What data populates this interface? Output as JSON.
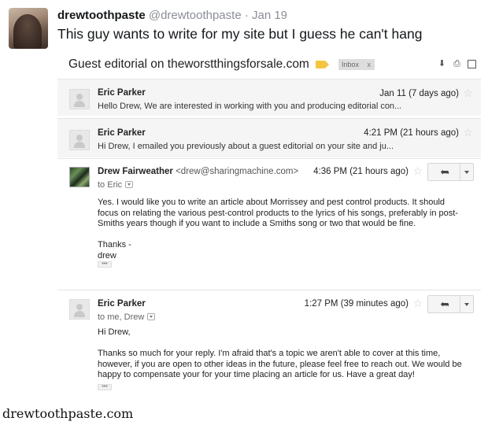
{
  "tweet": {
    "author_name": "drewtoothpaste",
    "author_handle": "@drewtoothpaste",
    "date": "· Jan 19",
    "text": "This guy wants to write for my site but I guess he can't hang"
  },
  "thread": {
    "subject": "Guest editorial on theworstthingsforsale.com",
    "label_chip": "Inbox",
    "label_chip_close": "x",
    "icons": [
      "download-icon",
      "print-icon",
      "new-window-icon"
    ],
    "messages": [
      {
        "sender": "Eric Parker",
        "when": "Jan 11 (7 days ago)",
        "snippet": "Hello Drew, We are interested in working with you and producing editorial con..."
      },
      {
        "sender": "Eric Parker",
        "when": "4:21 PM (21 hours ago)",
        "snippet": "Hi Drew, I emailed you previously about a guest editorial on your site and ju..."
      },
      {
        "sender": "Drew Fairweather",
        "sender_email": "<drew@sharingmachine.com>",
        "when": "4:36 PM (21 hours ago)",
        "to": "to Eric",
        "body": [
          "Yes. I would like you to write an article about Morrissey and pest control products. It should focus on relating the various pest-control products to the lyrics of his songs, preferably in post-Smiths years though if you want to include a Smiths song or two that would be fine.",
          "Thanks -",
          "drew"
        ]
      },
      {
        "sender": "Eric Parker",
        "when": "1:27 PM (39 minutes ago)",
        "to": "to me, Drew",
        "body": [
          "Hi Drew,",
          "Thanks so much for your reply. I'm afraid that's a topic we aren't able to cover at this time, however, if you are open to other ideas in the future, please feel free to reach out. We would be happy to compensate your for your time placing an article for us. Have a great day!"
        ]
      }
    ]
  },
  "watermark": "drewtoothpaste.com",
  "glyphs": {
    "star": "☆",
    "reply": "➦",
    "ellipsis": "•••"
  }
}
